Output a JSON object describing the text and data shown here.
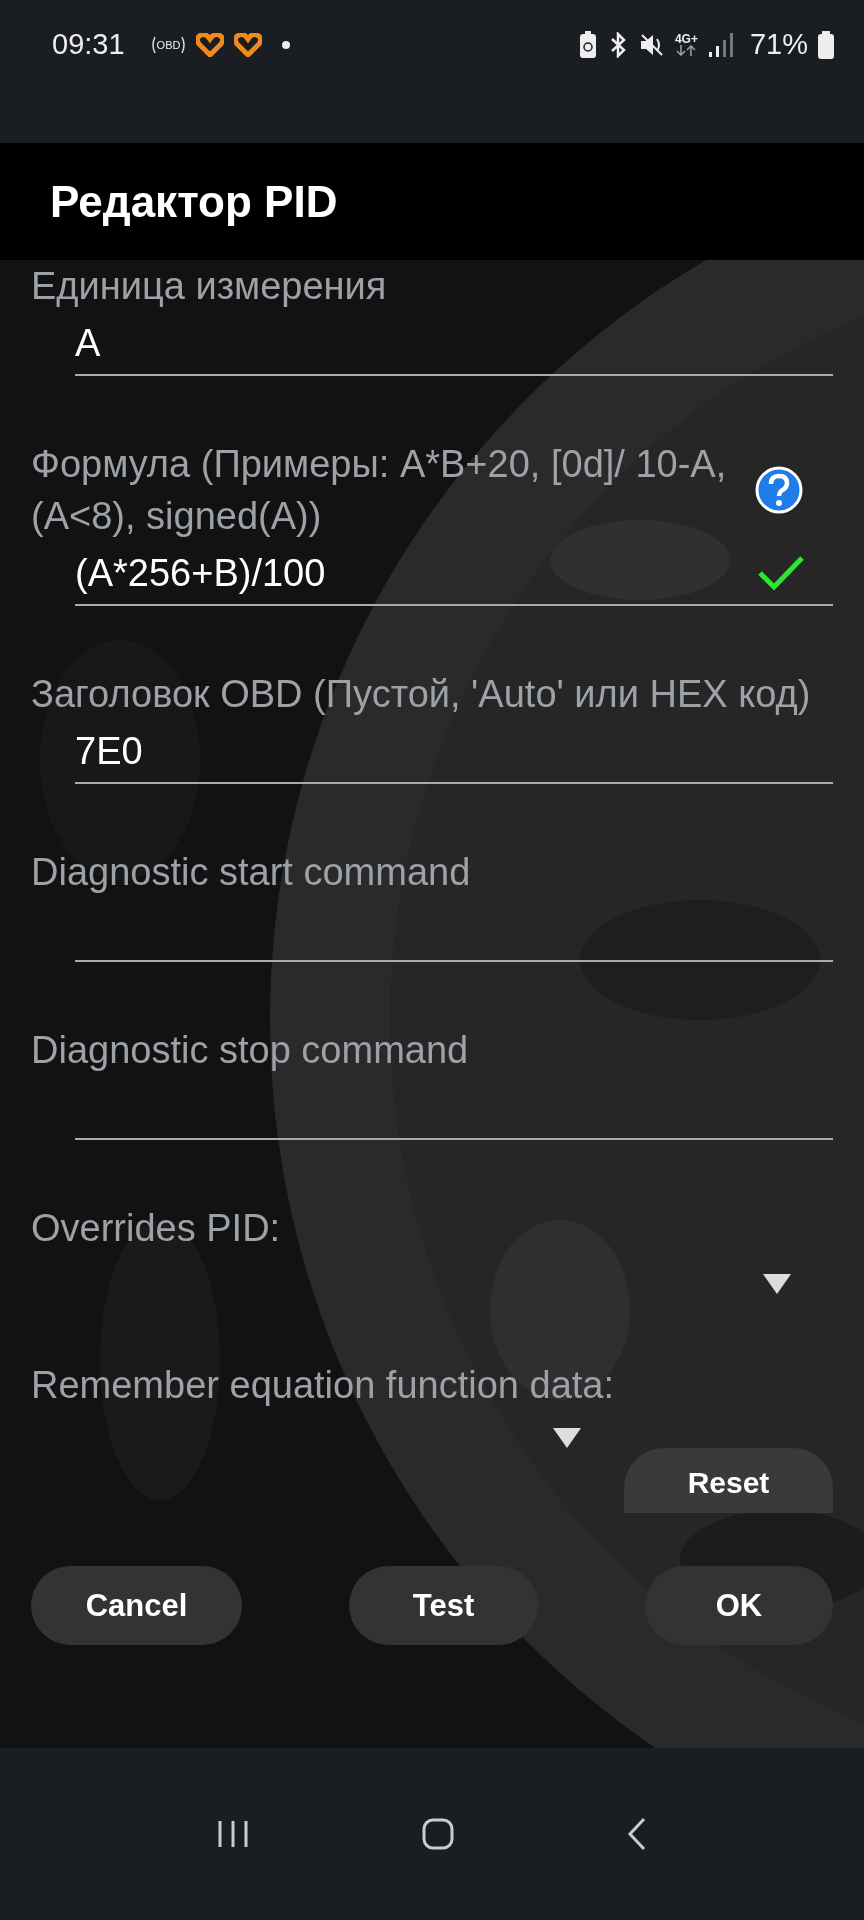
{
  "status_bar": {
    "time": "09:31",
    "obd_badge": "OBD",
    "network": "4G+",
    "battery": "71%"
  },
  "title": "Редактор PID",
  "fields": [
    {
      "kind": "text",
      "label": "Единица измерения",
      "value": "A"
    },
    {
      "kind": "formula",
      "label": "Формула (Примеры: A*B+20, [0d]/ 10-A, (A<8), signed(A))",
      "value": "(A*256+B)/100",
      "valid": true
    },
    {
      "kind": "text",
      "label": "Заголовок OBD (Пустой, 'Auto' или HEX код)",
      "value": "7E0"
    },
    {
      "kind": "text",
      "label": "Diagnostic start command"
    },
    {
      "kind": "text",
      "label": "Diagnostic stop command"
    },
    {
      "kind": "dropdown",
      "label": "Overrides PID:"
    },
    {
      "kind": "dropdown",
      "label": "Remember equation function data:"
    }
  ],
  "reset_button": "Reset",
  "buttons": [
    "Cancel",
    "Test",
    "OK"
  ]
}
